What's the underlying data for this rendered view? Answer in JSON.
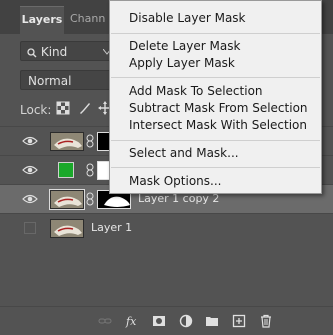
{
  "tabs": {
    "active": "Layers",
    "inactive": "Chann"
  },
  "filter": {
    "label": "Kind"
  },
  "blend_mode": "Normal",
  "lock": {
    "label": "Lock:"
  },
  "layers": [
    {
      "name": "",
      "visible": true
    },
    {
      "name": "",
      "visible": true
    },
    {
      "name": "Layer 1 copy 2",
      "visible": true,
      "selected": true
    },
    {
      "name": "Layer 1",
      "visible": false
    }
  ],
  "context_menu": {
    "items": [
      "Disable Layer Mask",
      "Delete Layer Mask",
      "Apply Layer Mask",
      "Add Mask To Selection",
      "Subtract Mask From Selection",
      "Intersect Mask With Selection",
      "Select and Mask...",
      "Mask Options..."
    ]
  },
  "bottom_icons": [
    "link-icon",
    "fx-icon",
    "add-mask-icon",
    "adjustment-icon",
    "folder-icon",
    "new-layer-icon",
    "trash-icon"
  ],
  "colors": {
    "panel_bg": "#535353",
    "menu_bg": "#f0f0f0",
    "selected_row": "#6b6b6b",
    "fill_green": "#1aa82a"
  }
}
